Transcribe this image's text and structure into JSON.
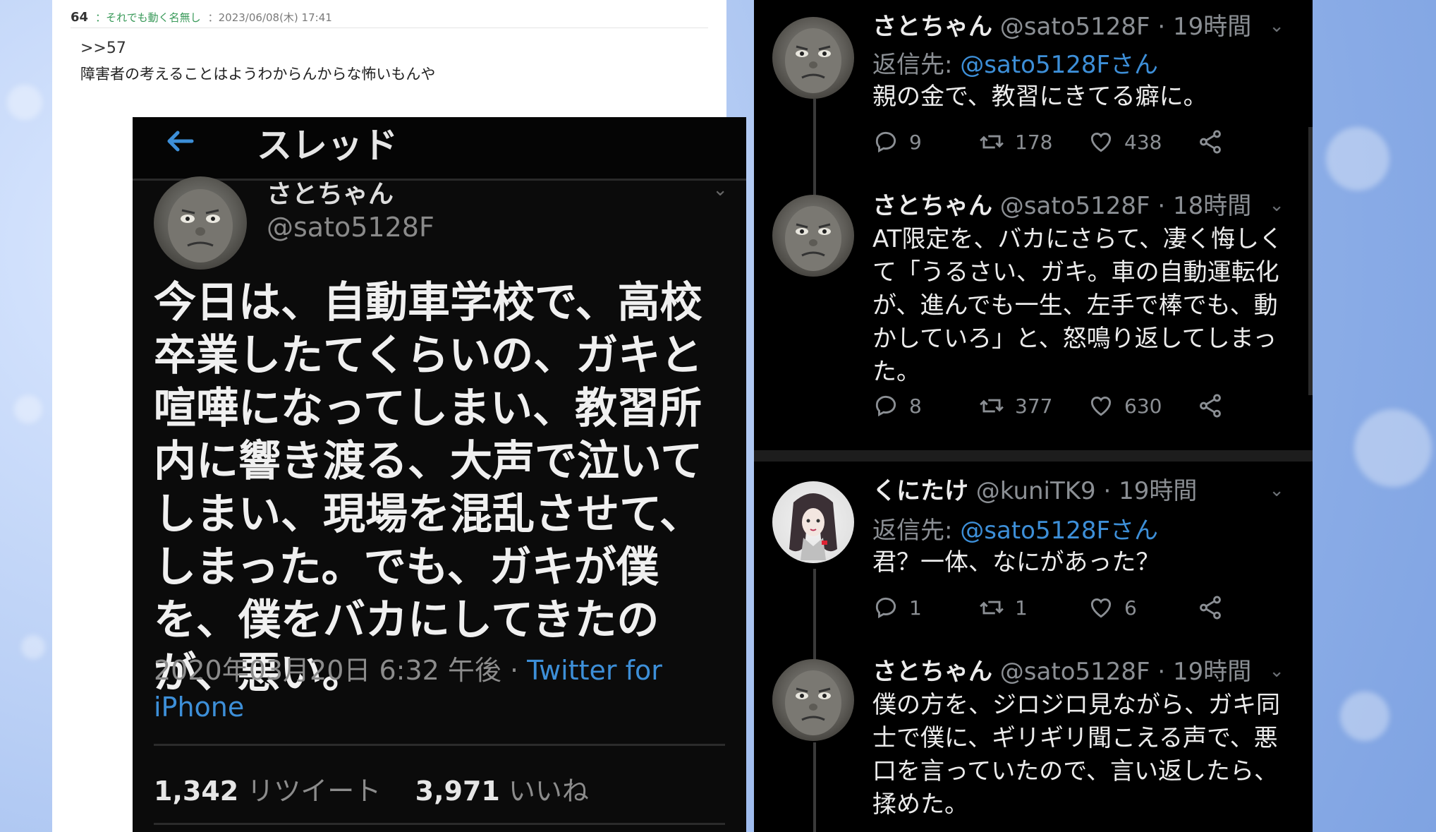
{
  "forum": {
    "post_number": "64",
    "post_name": "：それでも動く名無し",
    "post_date": "：2023/06/08(木) 17:41",
    "anchor": ">>57",
    "text": "障害者の考えることはようわからんからな怖いもんや"
  },
  "embed": {
    "back_icon": "arrow-left-icon",
    "title": "スレッド",
    "name": "さとちゃん",
    "handle": "@sato5128F",
    "body": "今日は、自動車学校で、高校卒業したてくらいの、ガキと喧嘩になってしまい、教習所内に響き渡る、大声で泣いてしまい、現場を混乱させて、しまった。でも、ガキが僕を、僕をバカにしてきたのが、悪い。",
    "date": "2020年03月20日 6:32 午後 · ",
    "source": "Twitter for iPhone",
    "retweets_count": "1,342",
    "retweets_label": " リツイート",
    "likes_count": "3,971",
    "likes_label": " いいね"
  },
  "tweets": [
    {
      "name": "さとちゃん",
      "handle": " @sato5128F · 19時間",
      "reply_prefix": "返信先: ",
      "reply_to": "@sato5128Fさん",
      "text": "親の金で、教習にきてる癖に。",
      "replies": "9",
      "retweets": "178",
      "likes": "438"
    },
    {
      "name": "さとちゃん",
      "handle": " @sato5128F · 18時間",
      "text": "AT限定を、バカにさらて、凄く悔しくて「うるさい、ガキ。車の自動運転化が、進んでも一生、左手で棒でも、動かしていろ」と、怒鳴り返してしまった。",
      "replies": "8",
      "retweets": "377",
      "likes": "630"
    },
    {
      "name": "くにたけ",
      "handle": " @kuniTK9 · 19時間",
      "reply_prefix": "返信先: ",
      "reply_to": "@sato5128Fさん",
      "text": "君？一体、なにがあった？",
      "replies": "1",
      "retweets": "1",
      "likes": "6"
    },
    {
      "name": "さとちゃん",
      "handle": " @sato5128F · 19時間",
      "text": "僕の方を、ジロジロ見ながら、ガキ同士で僕に、ギリギリ聞こえる声で、悪口を言っていたので、言い返したら、揉めた。"
    }
  ],
  "icons": {
    "reply": "reply-icon",
    "retweet": "retweet-icon",
    "like": "heart-icon",
    "share": "share-icon",
    "caret": "chevron-down-icon"
  },
  "colors": {
    "link_blue": "#3d8fd8",
    "dark_bg": "#000000",
    "forum_name_green": "#3a9a5a"
  }
}
